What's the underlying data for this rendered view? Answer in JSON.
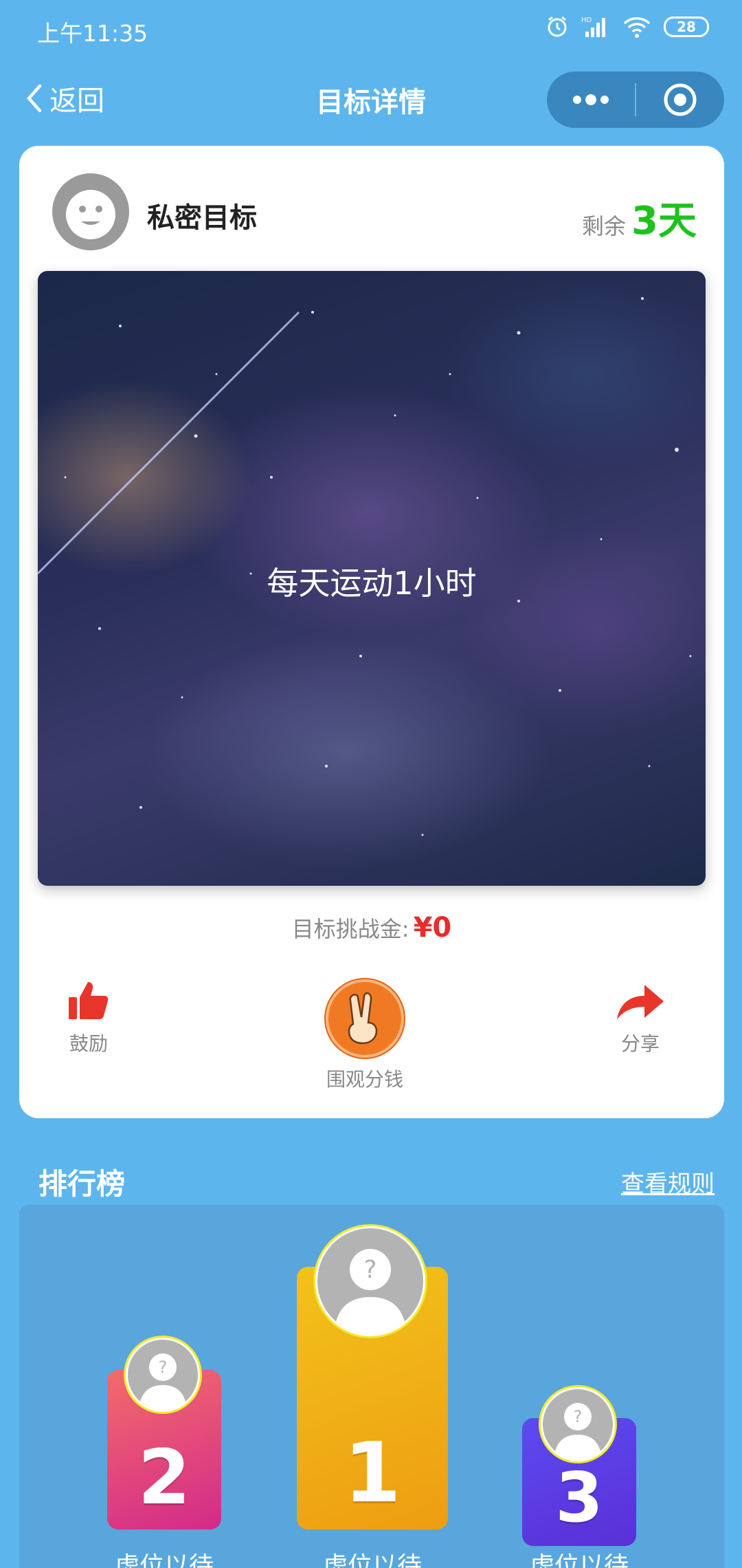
{
  "status": {
    "time": "上午11:35",
    "battery": "28"
  },
  "nav": {
    "back_label": "返回",
    "title": "目标详情"
  },
  "card": {
    "title": "私密目标",
    "remain_label": "剩余",
    "remain_value": "3天",
    "hero_text": "每天运动1小时",
    "bounty_label": "目标挑战金:",
    "bounty_value": "¥0",
    "actions": [
      {
        "label": "鼓励",
        "icon": "thumbs-up-icon"
      },
      {
        "label": "围观分钱",
        "icon": "peace-hand-icon"
      },
      {
        "label": "分享",
        "icon": "share-arrow-icon"
      }
    ]
  },
  "leaderboard": {
    "title": "排行榜",
    "rules_link": "查看规则",
    "ranks": [
      {
        "rank": "2",
        "name": "虚位以待",
        "color": "#e0437a"
      },
      {
        "rank": "1",
        "name": "虚位以待",
        "color": "#f0b21a"
      },
      {
        "rank": "3",
        "name": "虚位以待",
        "color": "#5b3fe6"
      }
    ]
  },
  "colors": {
    "background": "#5db5ee",
    "remain": "#1ec11e",
    "bounty": "#e82c2c"
  }
}
